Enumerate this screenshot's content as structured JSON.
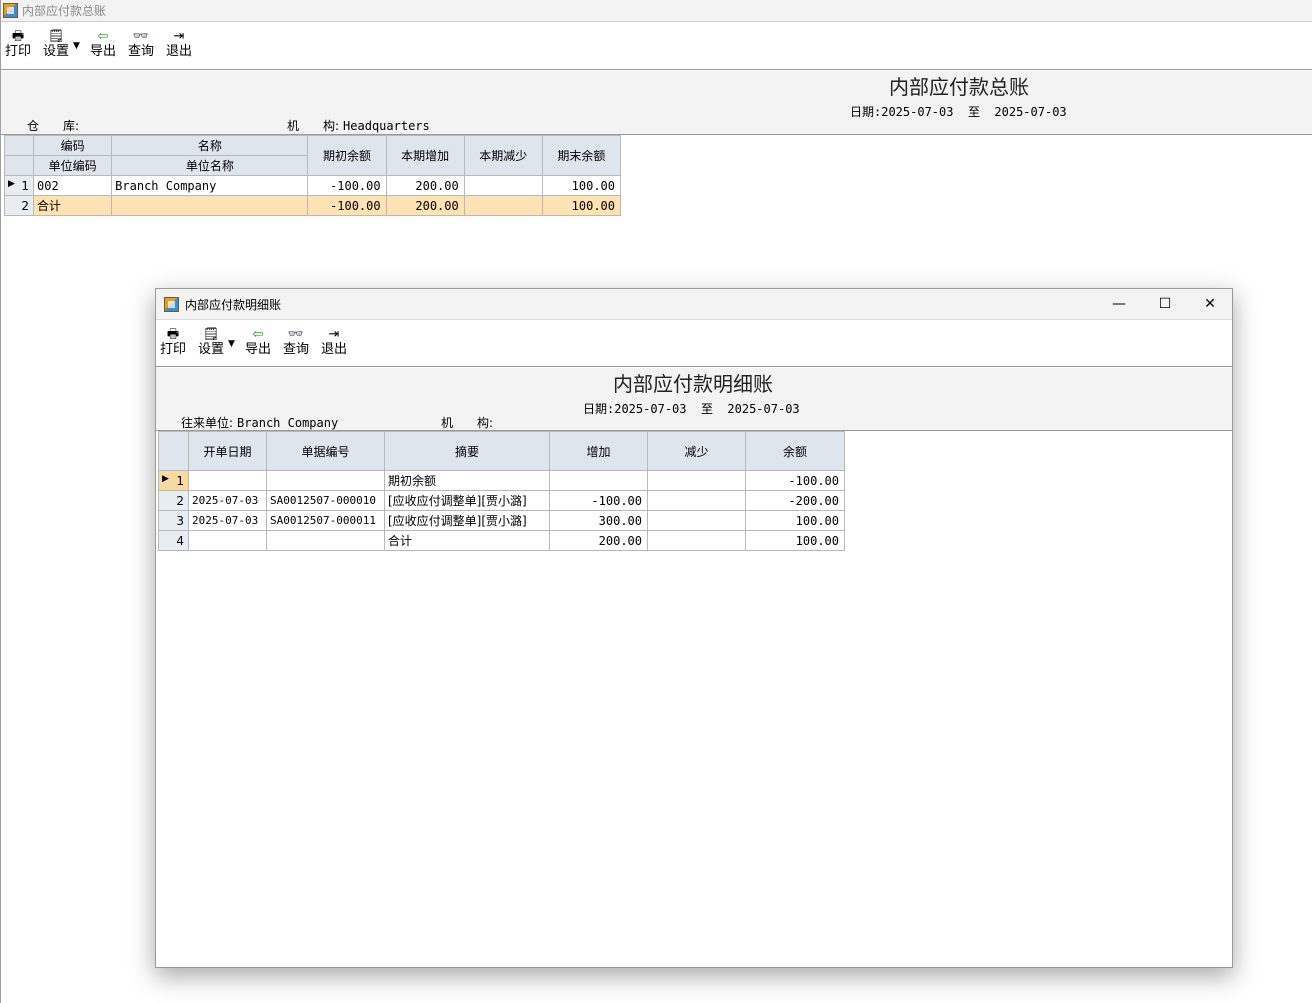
{
  "main": {
    "window_title": "内部应付款总账",
    "toolbar": {
      "print": "打印",
      "settings": "设置",
      "export": "导出",
      "query": "查询",
      "exit": "退出"
    },
    "report_title": "内部应付款总账",
    "date_label": "日期:",
    "date_from": "2025-07-03",
    "date_to_word": "至",
    "date_to": "2025-07-03",
    "warehouse_label": "仓　　库:",
    "warehouse_value": "",
    "org_label": "机　　构:",
    "org_value": "Headquarters",
    "table": {
      "headers": {
        "code": "编码",
        "name": "名称",
        "unit_code": "单位编码",
        "unit_name": "单位名称",
        "opening": "期初余额",
        "increase": "本期增加",
        "decrease": "本期减少",
        "closing": "期末余额"
      },
      "rows": [
        {
          "idx": "1",
          "code": "002",
          "name": "Branch Company",
          "opening": "-100.00",
          "increase": "200.00",
          "decrease": "",
          "closing": "100.00"
        },
        {
          "idx": "2",
          "code": "合计",
          "name": "",
          "opening": "-100.00",
          "increase": "200.00",
          "decrease": "",
          "closing": "100.00"
        }
      ]
    }
  },
  "dialog": {
    "window_title": "内部应付款明细账",
    "toolbar": {
      "print": "打印",
      "settings": "设置",
      "export": "导出",
      "query": "查询",
      "exit": "退出"
    },
    "report_title": "内部应付款明细账",
    "date_label": "日期:",
    "date_from": "2025-07-03",
    "date_to_word": "至",
    "date_to": "2025-07-03",
    "partner_label": "往来单位:",
    "partner_value": "Branch Company",
    "org_label": "机　　构:",
    "org_value": "",
    "table": {
      "headers": {
        "date": "开单日期",
        "doc_no": "单据编号",
        "summary": "摘要",
        "increase": "增加",
        "decrease": "减少",
        "balance": "余额"
      },
      "rows": [
        {
          "idx": "1",
          "date": "",
          "doc_no": "",
          "summary": "期初余额",
          "increase": "",
          "decrease": "",
          "balance": "-100.00"
        },
        {
          "idx": "2",
          "date": "2025-07-03",
          "doc_no": "SA0012507-000010",
          "summary": "[应收应付调整单][贾小潞]",
          "increase": "-100.00",
          "decrease": "",
          "balance": "-200.00"
        },
        {
          "idx": "3",
          "date": "2025-07-03",
          "doc_no": "SA0012507-000011",
          "summary": "[应收应付调整单][贾小潞]",
          "increase": "300.00",
          "decrease": "",
          "balance": "100.00"
        },
        {
          "idx": "4",
          "date": "",
          "doc_no": "",
          "summary": "合计",
          "increase": "200.00",
          "decrease": "",
          "balance": "100.00"
        }
      ]
    },
    "window_controls": {
      "minimize": "—",
      "maximize": "☐",
      "close": "✕"
    }
  }
}
